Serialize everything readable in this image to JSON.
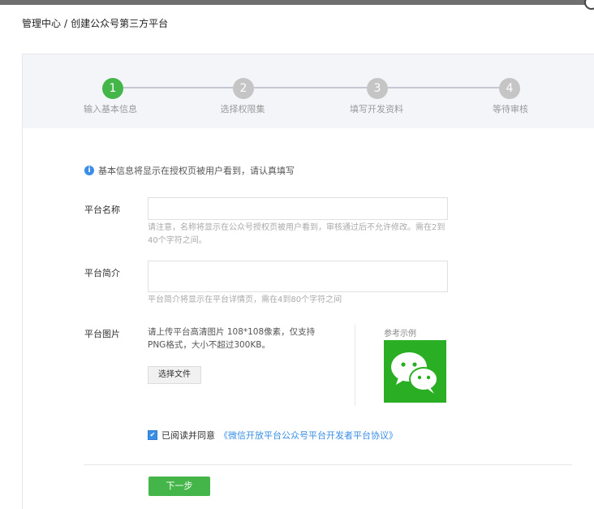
{
  "breadcrumb": {
    "root": "管理中心",
    "separator": "/",
    "current": "创建公众号第三方平台"
  },
  "steps": [
    {
      "number": "1",
      "label": "输入基本信息",
      "active": true
    },
    {
      "number": "2",
      "label": "选择权限集",
      "active": false
    },
    {
      "number": "3",
      "label": "填写开发资料",
      "active": false
    },
    {
      "number": "4",
      "label": "等待审核",
      "active": false
    }
  ],
  "info": {
    "icon": "info-icon",
    "text": "基本信息将显示在授权页被用户看到，请认真填写"
  },
  "form": {
    "name": {
      "label": "平台名称",
      "value": "",
      "hint": "请注意，名称将显示在公众号授权页被用户看到，审核通过后不允许修改。需在2到40个字符之间。"
    },
    "intro": {
      "label": "平台简介",
      "value": "",
      "hint": "平台简介将显示在平台详情页，需在4到80个字符之间"
    },
    "image": {
      "label": "平台图片",
      "hint": "请上传平台高清图片 108*108像素，仅支持PNG格式，大小不超过300KB。",
      "button": "选择文件",
      "reference_label": "参考示例",
      "reference_icon": "wechat-logo-icon"
    }
  },
  "agreement": {
    "checked": true,
    "prefix": "已阅读并同意",
    "link": "《微信开放平台公众号平台开发者平台协议》"
  },
  "next_button": "下一步",
  "colors": {
    "accent_green": "#44b549",
    "link_blue": "#3a8ee6",
    "step_inactive": "#c5c5c5",
    "wechat_green": "#2aae23"
  }
}
